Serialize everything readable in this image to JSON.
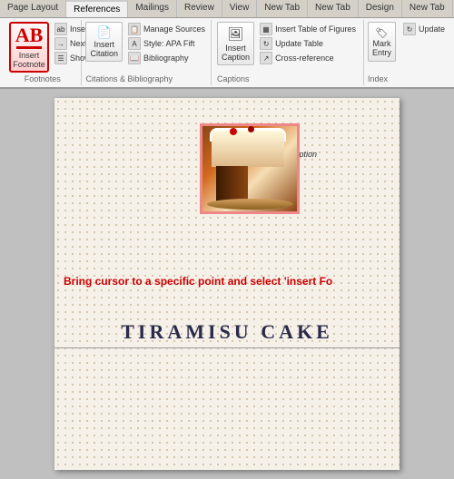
{
  "ribbon": {
    "tabs": [
      {
        "label": "Page Layout",
        "active": false
      },
      {
        "label": "References",
        "active": true
      },
      {
        "label": "Mailings",
        "active": false
      },
      {
        "label": "Review",
        "active": false
      },
      {
        "label": "View",
        "active": false
      },
      {
        "label": "New Tab",
        "active": false
      },
      {
        "label": "New Tab",
        "active": false
      },
      {
        "label": "Design",
        "active": false
      },
      {
        "label": "New Tab",
        "active": false
      }
    ],
    "groups": {
      "footnotes": {
        "label": "Footnotes",
        "insert_footnote": "Insert\nFootnote",
        "insert_endnote": "Insert Endnote",
        "next_footnote": "Next Footnote",
        "show_notes": "Show Notes"
      },
      "citations": {
        "label": "Citations & Bibliography",
        "manage_sources": "Manage Sources",
        "style": "Style: APA Fift",
        "insert_citation": "Insert\nCitation",
        "bibliography": "Bibliography"
      },
      "captions": {
        "label": "Captions",
        "insert_table_of_figures": "Insert Table of Figures",
        "update_table": "Update Table",
        "insert_caption": "Insert\nCaption",
        "caption_label": "Caption",
        "cross_reference": "Cross-reference"
      },
      "index": {
        "label": "Index",
        "mark_entry": "Mark\nEntry",
        "update_index": "Update"
      }
    }
  },
  "document": {
    "instruction": "Bring cursor to a specific point and select 'insert Fo",
    "title": "TIRAMISU CAKE",
    "caption_text": "Caption"
  }
}
